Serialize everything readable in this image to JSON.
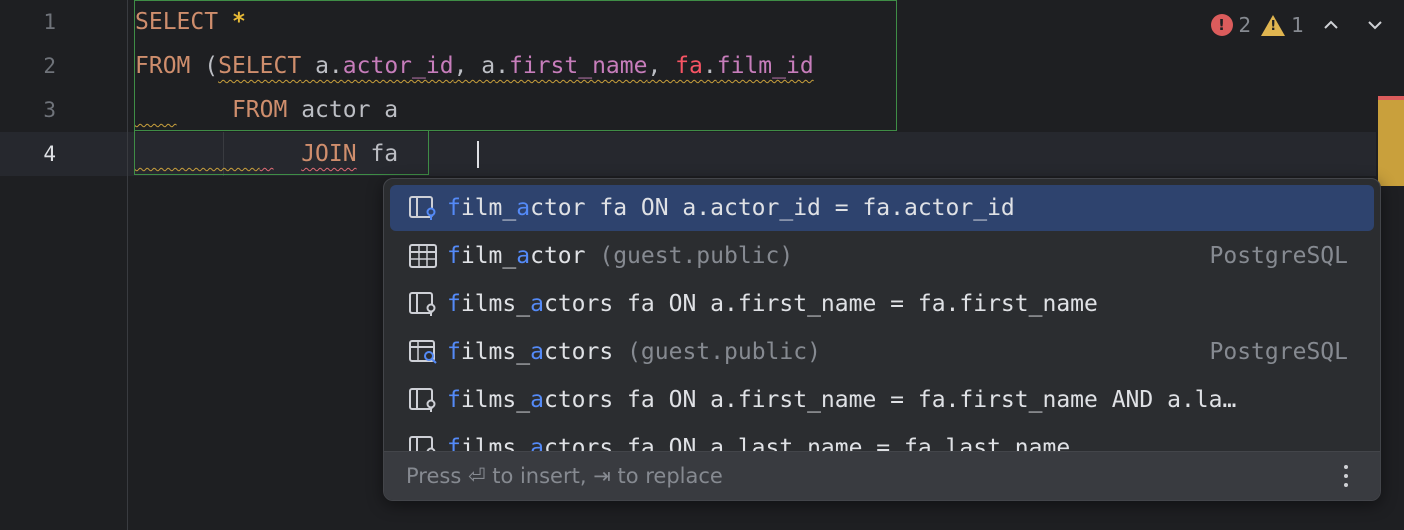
{
  "editor": {
    "line_numbers": [
      "1",
      "2",
      "3",
      "4"
    ],
    "lines": {
      "l1": {
        "kw_select": "SELECT",
        "star": "*"
      },
      "l2": {
        "kw_from": "FROM",
        "paren": "(",
        "kw_select": "SELECT",
        "a1": "a",
        "f1": "actor_id",
        "a2": "a",
        "f2": "first_name",
        "fa": "fa",
        "f3": "film_id"
      },
      "l3": {
        "kw_from": "FROM",
        "table": "actor",
        "alias": "a"
      },
      "l4": {
        "kw_join": "JOIN",
        "typed": "fa"
      }
    }
  },
  "inspections": {
    "errors": "2",
    "warnings": "1",
    "prev_icon": "chevron-up-icon",
    "next_icon": "chevron-down-icon",
    "error_color": "#db5c5c",
    "warning_color": "#e0b550"
  },
  "completion": {
    "items": [
      {
        "hl1": "f",
        "t1": "ilm_",
        "hl2": "a",
        "t2": "ctor fa ON a.actor_id = fa.actor_id",
        "schema": "",
        "right": "",
        "icon": "join-table-icon",
        "selected": true
      },
      {
        "hl1": "f",
        "t1": "ilm_",
        "hl2": "a",
        "t2": "ctor",
        "schema": " (guest.public)",
        "right": "PostgreSQL",
        "icon": "table-icon",
        "selected": false
      },
      {
        "hl1": "f",
        "t1": "ilms_",
        "hl2": "a",
        "t2": "ctors fa ON a.first_name = fa.first_name",
        "schema": "",
        "right": "",
        "icon": "join-table-icon",
        "selected": false
      },
      {
        "hl1": "f",
        "t1": "ilms_",
        "hl2": "a",
        "t2": "ctors",
        "schema": " (guest.public)",
        "right": "PostgreSQL",
        "icon": "table-search-icon",
        "selected": false
      },
      {
        "hl1": "f",
        "t1": "ilms_",
        "hl2": "a",
        "t2": "ctors fa ON a.first_name = fa.first_name AND a.la…",
        "schema": "",
        "right": "",
        "icon": "join-table-icon",
        "selected": false
      },
      {
        "hl1": "f",
        "t1": "ilms_",
        "hl2": "a",
        "t2": "ctors fa ON a.last_name = fa.last_name",
        "schema": "",
        "right": "",
        "icon": "join-table-icon",
        "selected": false
      }
    ],
    "footer": "Press ⏎ to insert, ⇥ to replace",
    "more_icon": "more-vertical-icon",
    "accent_color": "#548af7",
    "selected_bg": "#2e436e"
  }
}
